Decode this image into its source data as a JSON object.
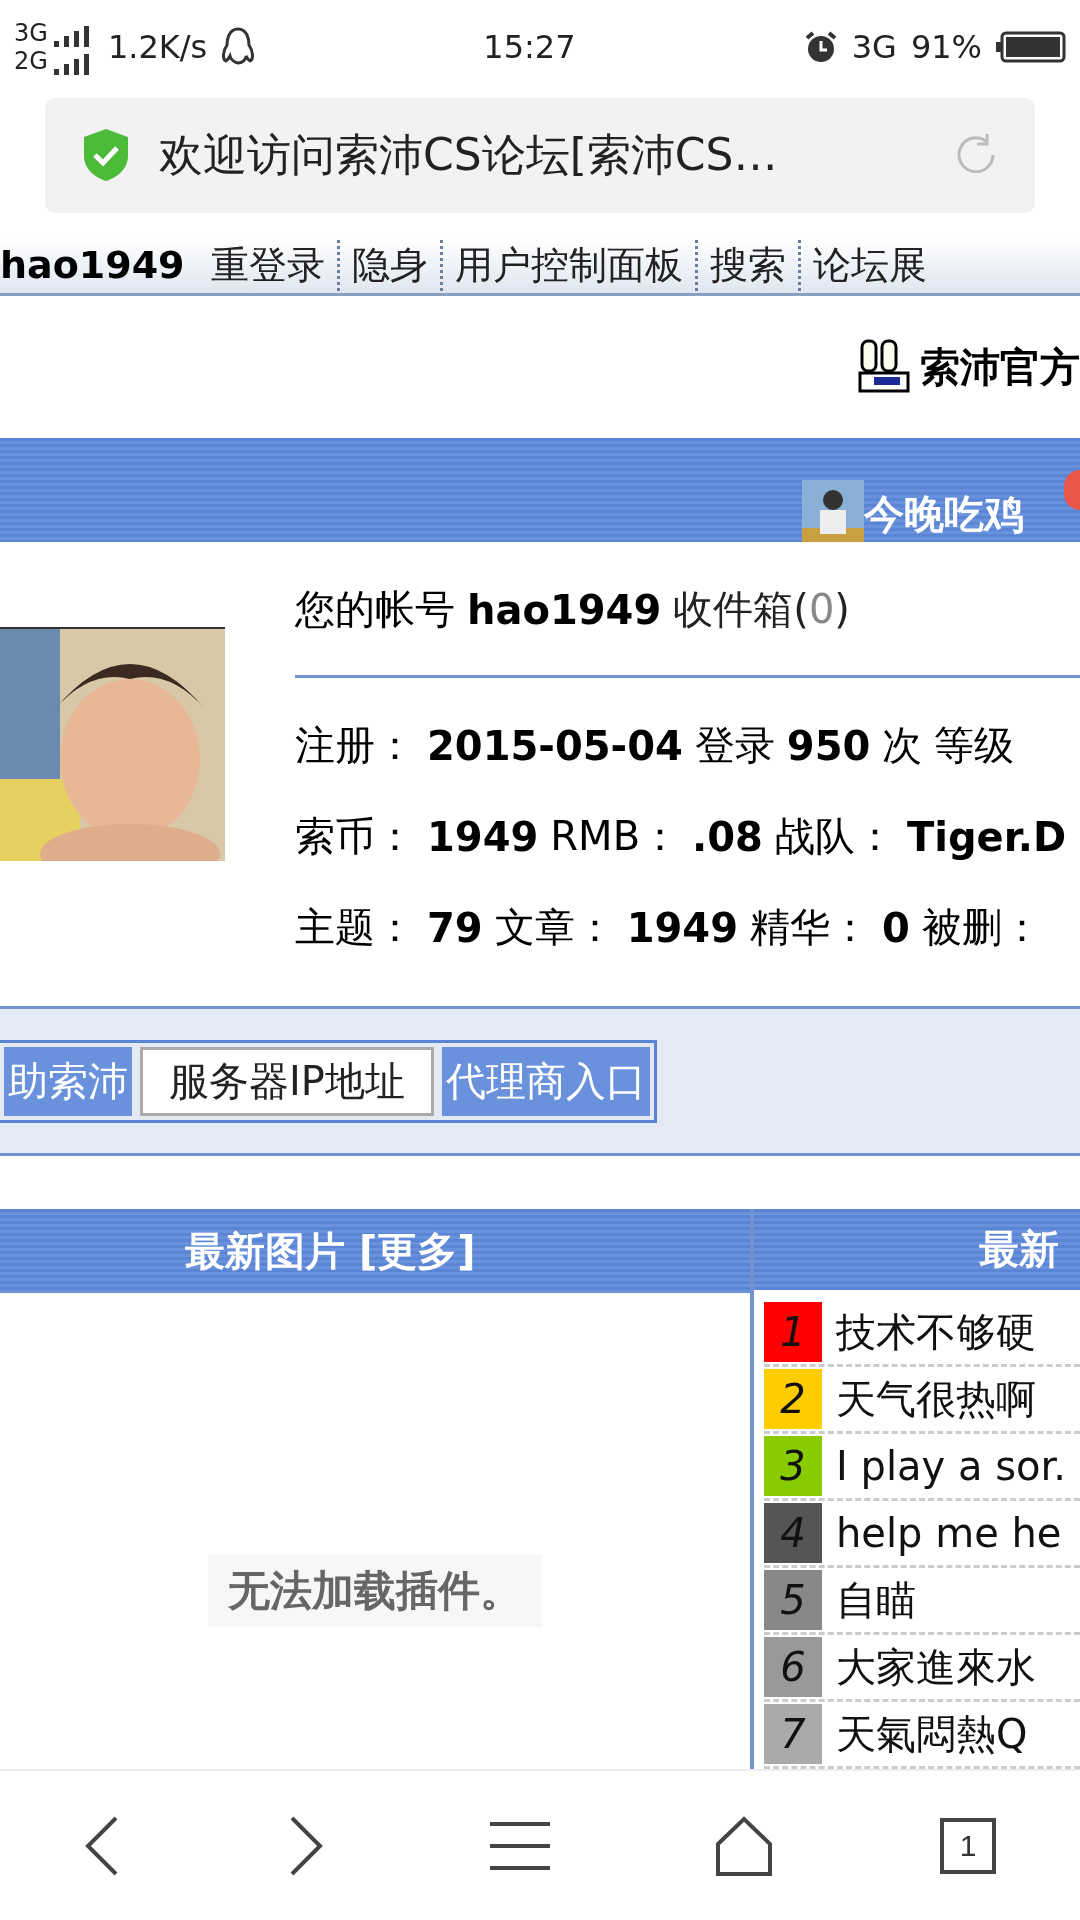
{
  "status_bar": {
    "network_top": "3G",
    "network_bottom": "2G",
    "speed": "1.2K/s",
    "time": "15:27",
    "network_right": "3G",
    "battery": "91%"
  },
  "address_bar": {
    "title": "欢迎访问索沛CS论坛[索沛CS…"
  },
  "top_nav": {
    "user": "hao1949",
    "links": [
      "重登录",
      "隐身",
      "用户控制面板",
      "搜索",
      "论坛展"
    ]
  },
  "banner": {
    "title": "索沛官方"
  },
  "header_bar": {
    "username": "今晚吃鸡"
  },
  "profile": {
    "account_label": "您的帐号",
    "account": "hao1949",
    "inbox_label": "收件箱(",
    "inbox_count": "0",
    "inbox_close": ")",
    "lines": [
      [
        {
          "text": "注册：",
          "bold": false
        },
        {
          "text": "2015-05-04",
          "bold": true
        },
        {
          "text": "登录",
          "bold": false
        },
        {
          "text": "950",
          "bold": true
        },
        {
          "text": "次",
          "bold": false
        },
        {
          "text": "等级",
          "bold": false
        }
      ],
      [
        {
          "text": "索币：",
          "bold": false
        },
        {
          "text": "1949",
          "bold": true
        },
        {
          "text": "RMB：",
          "bold": false
        },
        {
          "text": ".08",
          "bold": true
        },
        {
          "text": "战队：",
          "bold": false
        },
        {
          "text": "Tiger.D",
          "bold": true
        }
      ],
      [
        {
          "text": "主题：",
          "bold": false
        },
        {
          "text": "79",
          "bold": true
        },
        {
          "text": "文章：",
          "bold": false
        },
        {
          "text": "1949",
          "bold": true
        },
        {
          "text": "精华：",
          "bold": false
        },
        {
          "text": "0",
          "bold": true
        },
        {
          "text": "被删：",
          "bold": false
        }
      ]
    ]
  },
  "quick_links": [
    {
      "label": "助索沛",
      "selected": false
    },
    {
      "label": "服务器IP地址",
      "selected": true
    },
    {
      "label": "代理商入口",
      "selected": false
    }
  ],
  "latest_pictures": {
    "title": "最新图片 [更多]",
    "message": "无法加载插件。"
  },
  "latest_topics": {
    "title": "最新",
    "items": [
      {
        "rank": "1",
        "title": "技术不够硬",
        "color": "#ff0000"
      },
      {
        "rank": "2",
        "title": "天气很热啊",
        "color": "#ffcc00"
      },
      {
        "rank": "3",
        "title": "I play a sor.",
        "color": "#88cc00"
      },
      {
        "rank": "4",
        "title": "help me he",
        "color": "#555555"
      },
      {
        "rank": "5",
        "title": "自瞄",
        "color": "#888888"
      },
      {
        "rank": "6",
        "title": "大家進來水",
        "color": "#999999"
      },
      {
        "rank": "7",
        "title": "天氣悶熱Q",
        "color": "#aaaaaa"
      }
    ]
  },
  "bottom_bar": {
    "tab_count": "1"
  }
}
